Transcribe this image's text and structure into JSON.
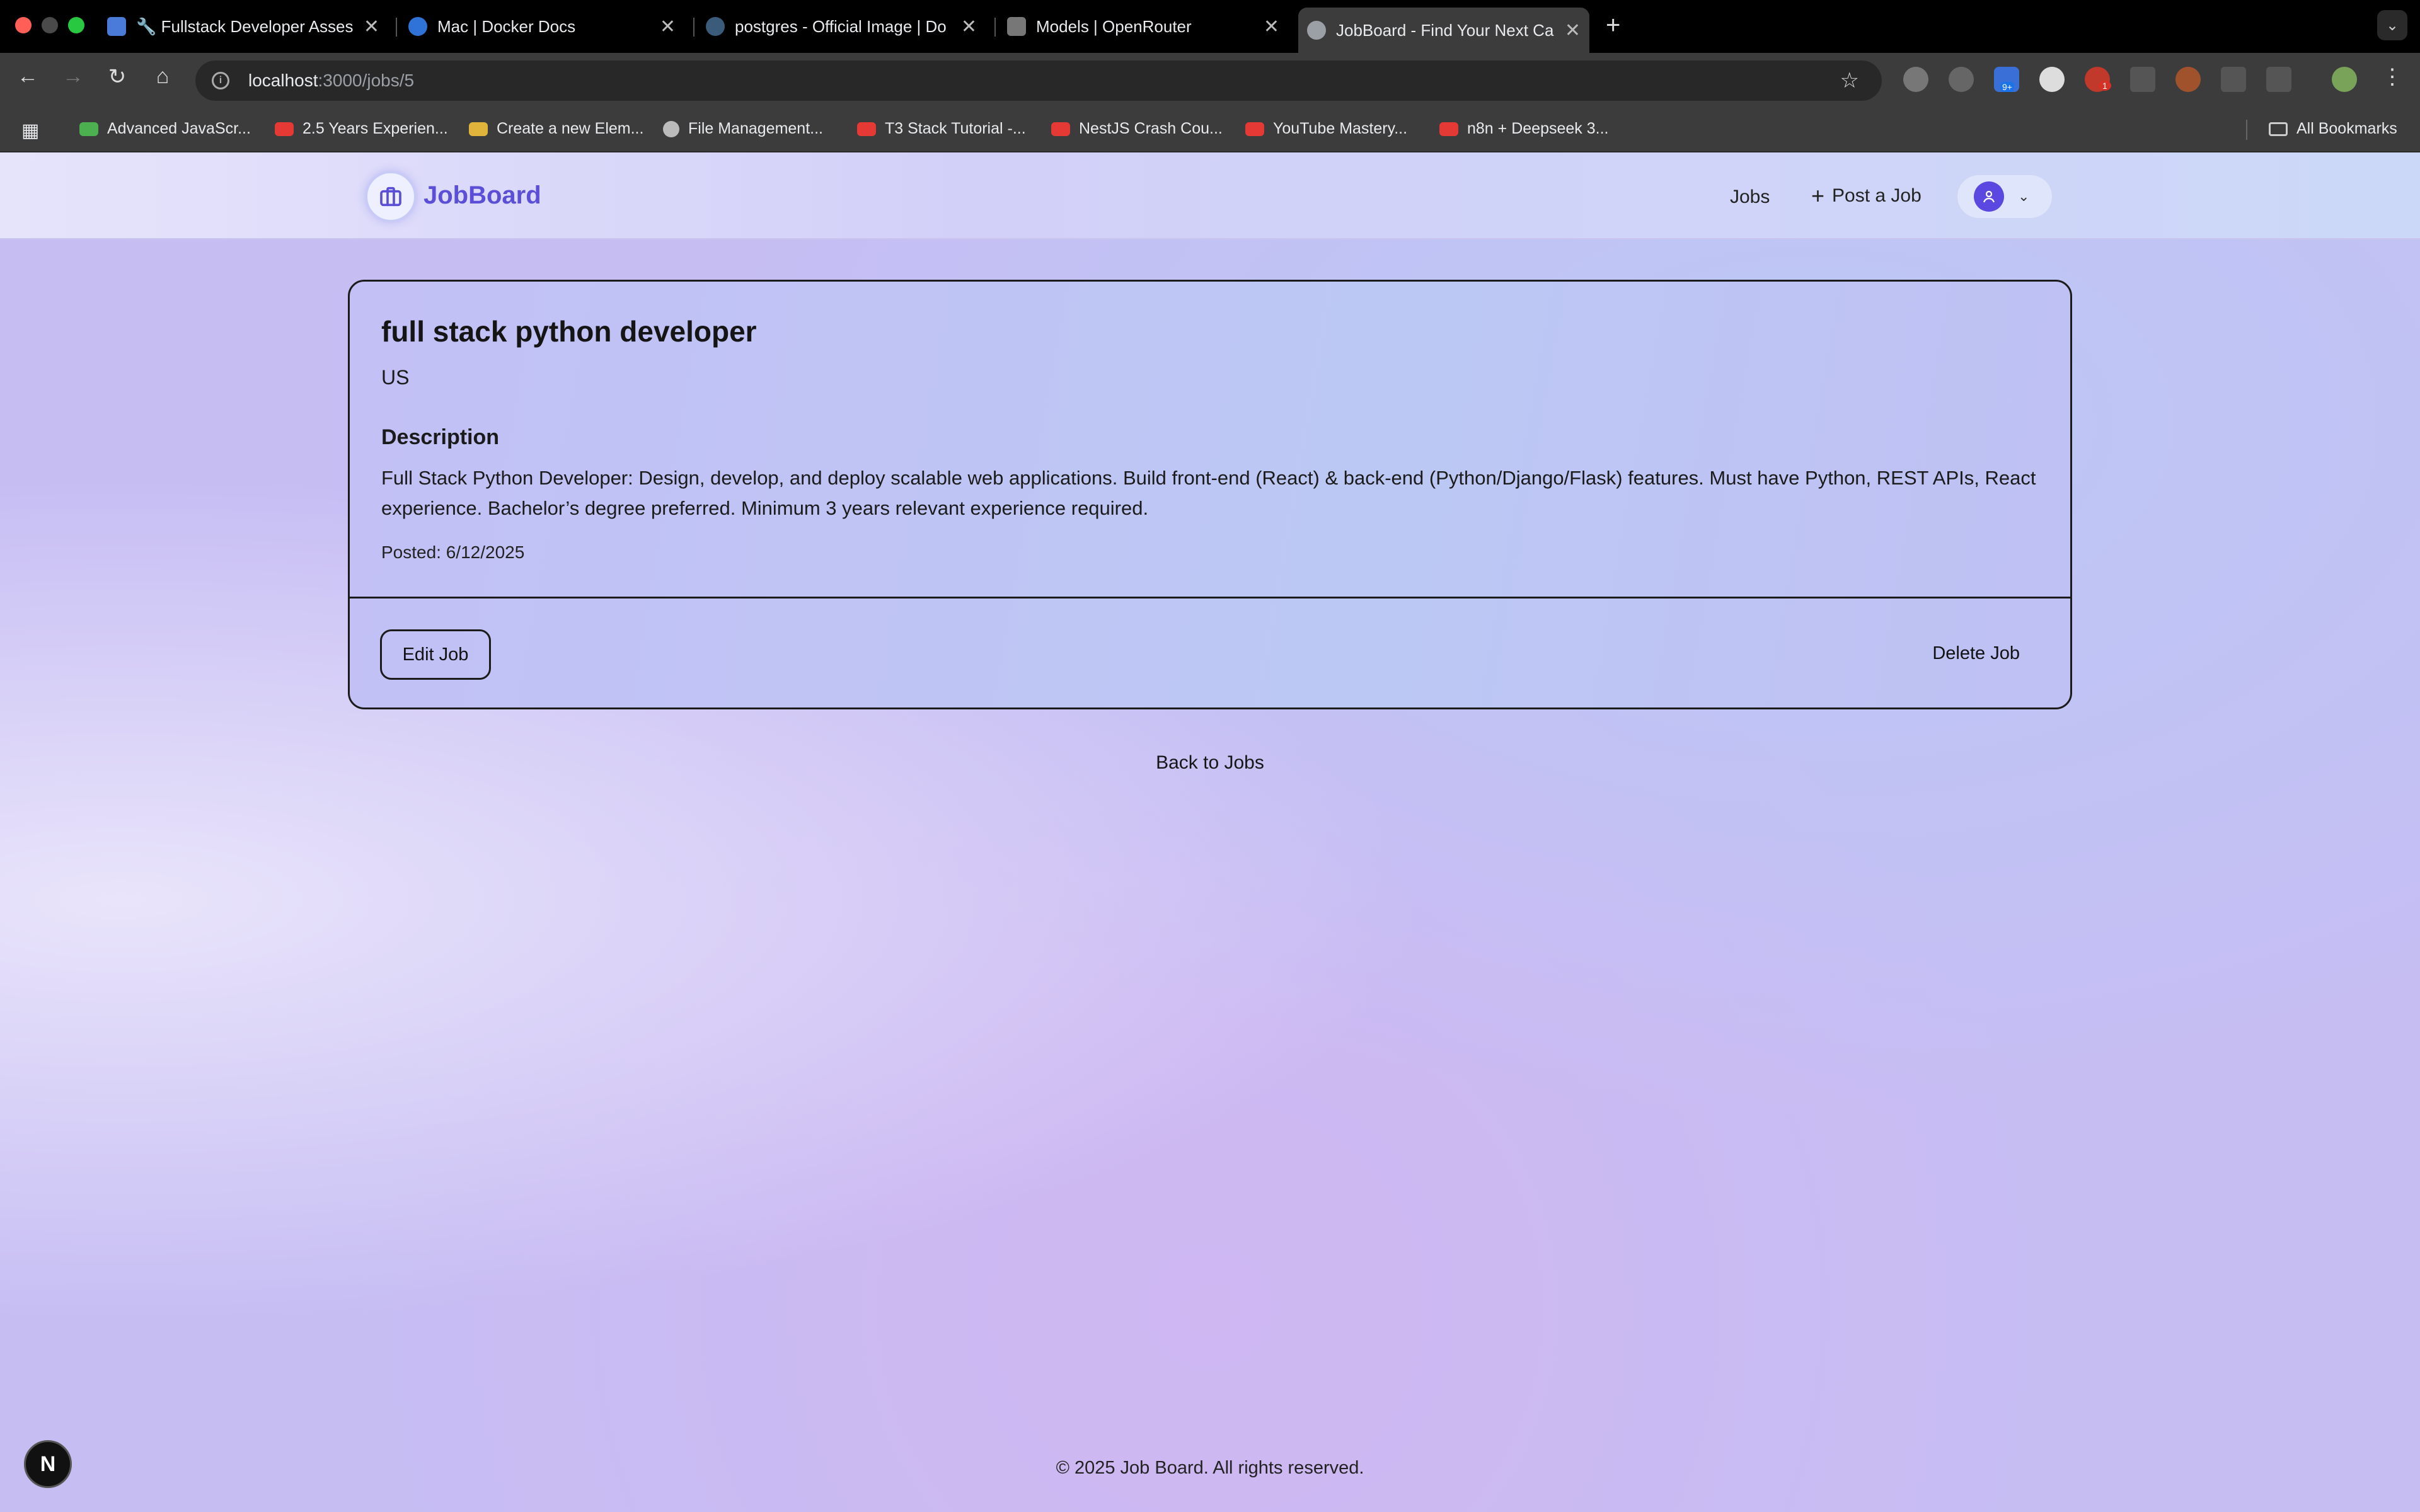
{
  "browser": {
    "tabs": [
      {
        "label": "🔧 Fullstack Developer Asses",
        "favicon_color": "#4a7bd8"
      },
      {
        "label": "Mac | Docker Docs",
        "favicon_color": "#2f73d8"
      },
      {
        "label": "postgres - Official Image | Do",
        "favicon_color": "#3b5b7a"
      },
      {
        "label": "Models | OpenRouter",
        "favicon_color": "#888888"
      },
      {
        "label": "JobBoard - Find Your Next Ca",
        "favicon_color": "#9aa0a6"
      }
    ],
    "url": {
      "host": "localhost",
      "path": ":3000/jobs/5"
    },
    "bookmarks": [
      {
        "label": "Advanced JavaScr...",
        "icon": "layers-icon"
      },
      {
        "label": "2.5 Years Experien...",
        "icon": "youtube-icon"
      },
      {
        "label": "Create a new Elem...",
        "icon": "app-icon"
      },
      {
        "label": "File Management...",
        "icon": "globe-icon"
      },
      {
        "label": "T3 Stack Tutorial -...",
        "icon": "youtube-icon"
      },
      {
        "label": "NestJS Crash Cou...",
        "icon": "youtube-icon"
      },
      {
        "label": "YouTube Mastery...",
        "icon": "youtube-icon"
      },
      {
        "label": "n8n + Deepseek 3...",
        "icon": "youtube-icon"
      }
    ],
    "all_bookmarks": "All Bookmarks",
    "extension_badge": "9+",
    "extension_badge2": "1"
  },
  "header": {
    "brand": "JobBoard",
    "nav_jobs": "Jobs",
    "nav_post": "Post a Job",
    "brand_color": "#5a4fd6"
  },
  "job": {
    "title": "full stack python developer",
    "location": "US",
    "description_heading": "Description",
    "description": "Full Stack Python Developer: Design, develop, and deploy scalable web applications. Build front-end (React) & back-end (Python/Django/Flask) features. Must have Python, REST APIs, React experience. Bachelor’s degree preferred. Minimum 3 years relevant experience required.",
    "posted": "Posted: 6/12/2025",
    "edit_label": "Edit Job",
    "delete_label": "Delete Job"
  },
  "back_link": "Back to Jobs",
  "footer": "© 2025 Job Board. All rights reserved.",
  "dev_badge": "N"
}
